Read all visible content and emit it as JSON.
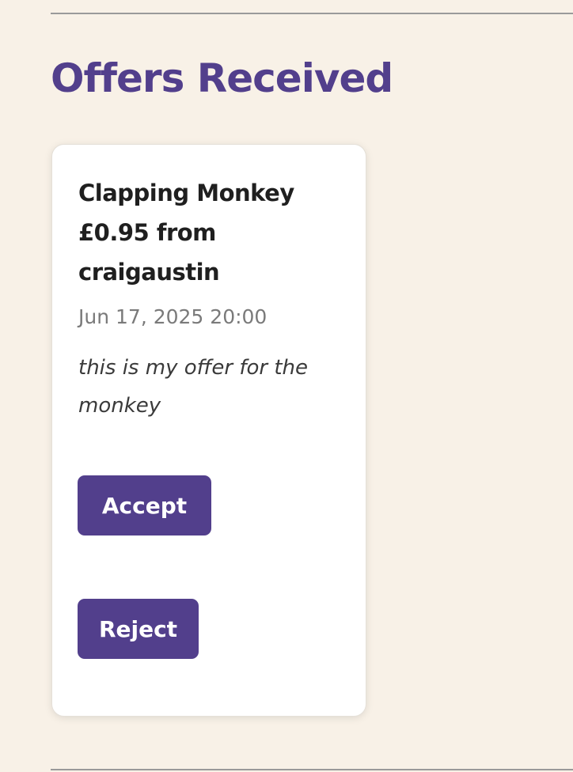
{
  "section": {
    "title": "Offers Received"
  },
  "offers": [
    {
      "heading_lines": [
        "Clapping Monkey",
        "£0.95 from",
        "craigaustin"
      ],
      "date": "Jun 17, 2025 20:00",
      "message": "this is my offer for the monkey",
      "accept_label": "Accept",
      "reject_label": "Reject"
    }
  ],
  "colors": {
    "accent": "#523f8c",
    "background": "#f8f1e7",
    "card": "#ffffff"
  }
}
